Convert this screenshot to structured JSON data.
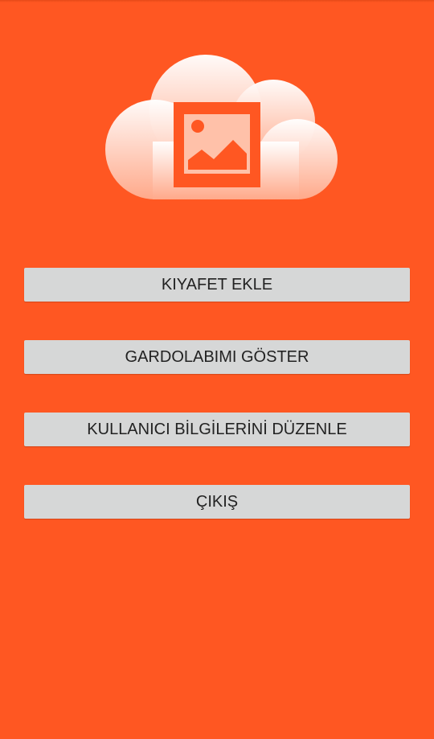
{
  "screen": {
    "background_color": "#ff5722"
  },
  "logo": {
    "icon": "cloud-image-icon"
  },
  "menu": {
    "add_clothes_label": "KIYAFET EKLE",
    "show_wardrobe_label": "GARDOLABIMI GÖSTER",
    "edit_user_info_label": "KULLANICI BİLGİLERİNİ DÜZENLE",
    "exit_label": "ÇIKIŞ",
    "button_color": "#d6d7d7",
    "text_color": "#222222"
  }
}
